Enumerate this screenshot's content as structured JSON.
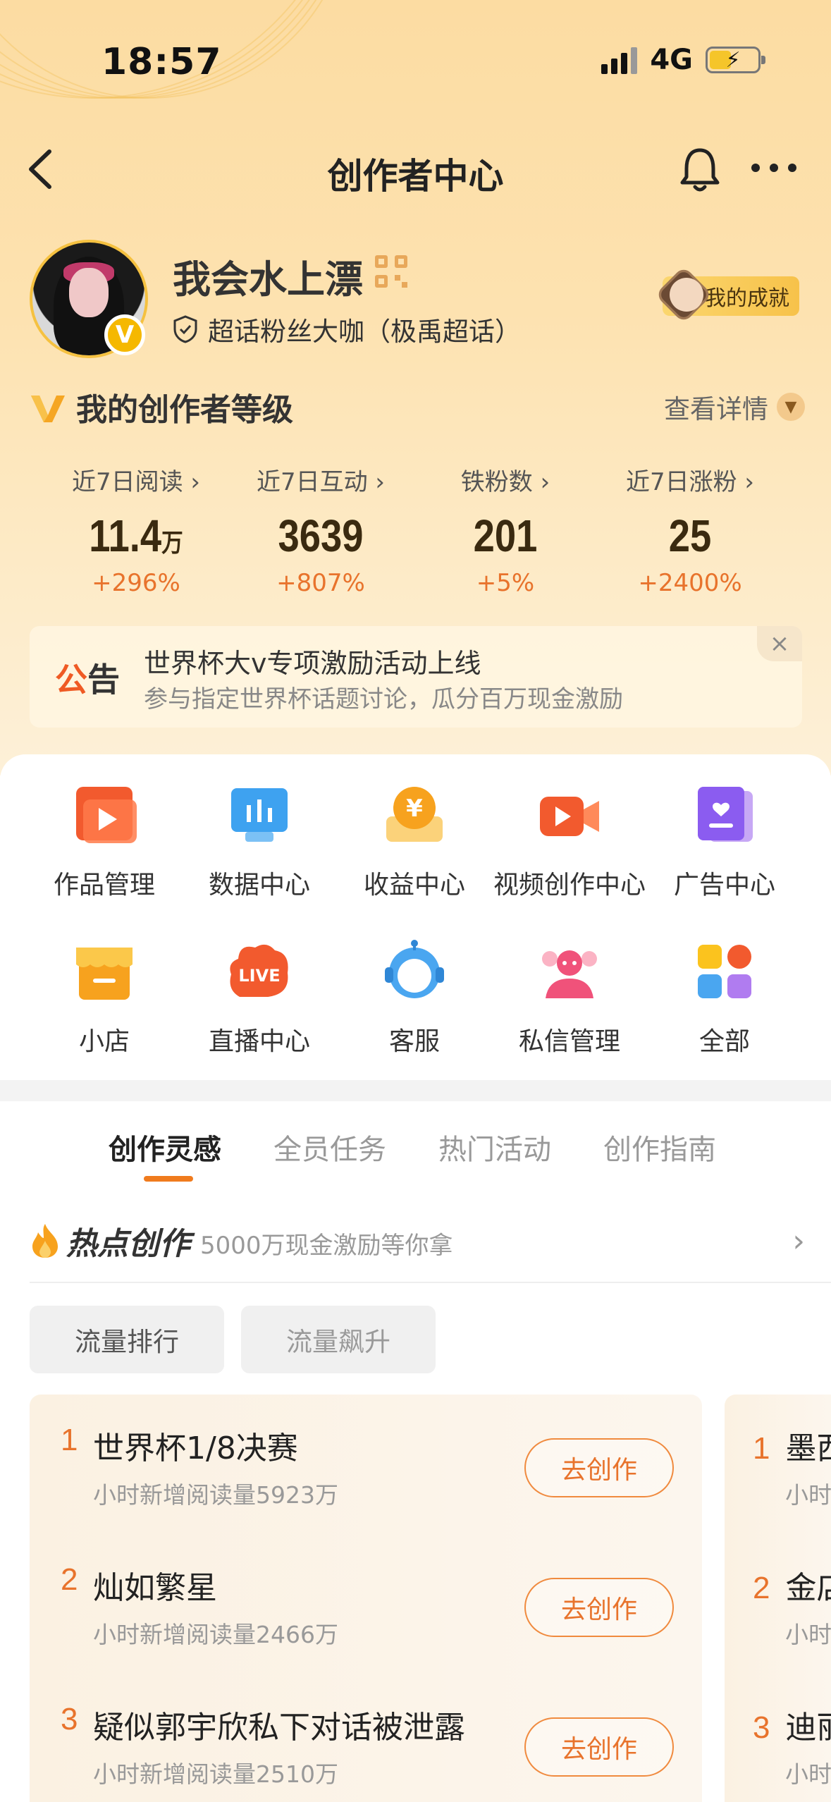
{
  "status": {
    "time": "18:57",
    "network": "4G"
  },
  "nav": {
    "title": "创作者中心"
  },
  "profile": {
    "name": "我会水上漂",
    "badge_letter": "V",
    "fan_title": "超话粉丝大咖（极禹超话）",
    "achievement": "我的成就"
  },
  "level": {
    "title": "我的创作者等级",
    "detail": "查看详情"
  },
  "stats": [
    {
      "label": "近7日阅读",
      "value": "11.4",
      "unit": "万",
      "change": "+296%"
    },
    {
      "label": "近7日互动",
      "value": "3639",
      "unit": "",
      "change": "+807%"
    },
    {
      "label": "铁粉数",
      "value": "201",
      "unit": "",
      "change": "+5%"
    },
    {
      "label": "近7日涨粉",
      "value": "25",
      "unit": "",
      "change": "+2400%"
    }
  ],
  "notice": {
    "badge_1": "公",
    "badge_2": "告",
    "title": "世界杯大v专项激励活动上线",
    "subtitle": "参与指定世界杯话题讨论，瓜分百万现金激励",
    "close": "×"
  },
  "grid": [
    {
      "label": "作品管理",
      "icon": "folder-play-icon"
    },
    {
      "label": "数据中心",
      "icon": "chart-screen-icon"
    },
    {
      "label": "收益中心",
      "icon": "yen-coin-icon"
    },
    {
      "label": "视频创作中心",
      "icon": "video-camera-icon"
    },
    {
      "label": "广告中心",
      "icon": "ad-heart-icon"
    },
    {
      "label": "小店",
      "icon": "shop-icon"
    },
    {
      "label": "直播中心",
      "icon": "live-icon"
    },
    {
      "label": "客服",
      "icon": "customer-service-icon"
    },
    {
      "label": "私信管理",
      "icon": "message-people-icon"
    },
    {
      "label": "全部",
      "icon": "all-apps-icon"
    }
  ],
  "tabs": [
    "创作灵感",
    "全员任务",
    "热门活动",
    "创作指南"
  ],
  "hot": {
    "title": "热点创作",
    "subtitle": "5000万现金激励等你拿",
    "chips": [
      "流量排行",
      "流量飙升"
    ],
    "items": [
      {
        "rank": "1",
        "title": "世界杯1/8决赛",
        "sub": "小时新增阅读量5923万",
        "button": "去创作"
      },
      {
        "rank": "2",
        "title": "灿如繁星",
        "sub": "小时新增阅读量2466万",
        "button": "去创作"
      },
      {
        "rank": "3",
        "title": "疑似郭宇欣私下对话被泄露",
        "sub": "小时新增阅读量2510万",
        "button": "去创作"
      }
    ],
    "peek": [
      {
        "rank": "1",
        "title": "墨西",
        "sub": "小时"
      },
      {
        "rank": "2",
        "title": "金店",
        "sub": "小时"
      },
      {
        "rank": "3",
        "title": "迪丽",
        "sub": "小时"
      }
    ]
  },
  "colors": {
    "accent": "#e8732c",
    "header_bg": "#fcdca2",
    "badge": "#f5b800"
  }
}
